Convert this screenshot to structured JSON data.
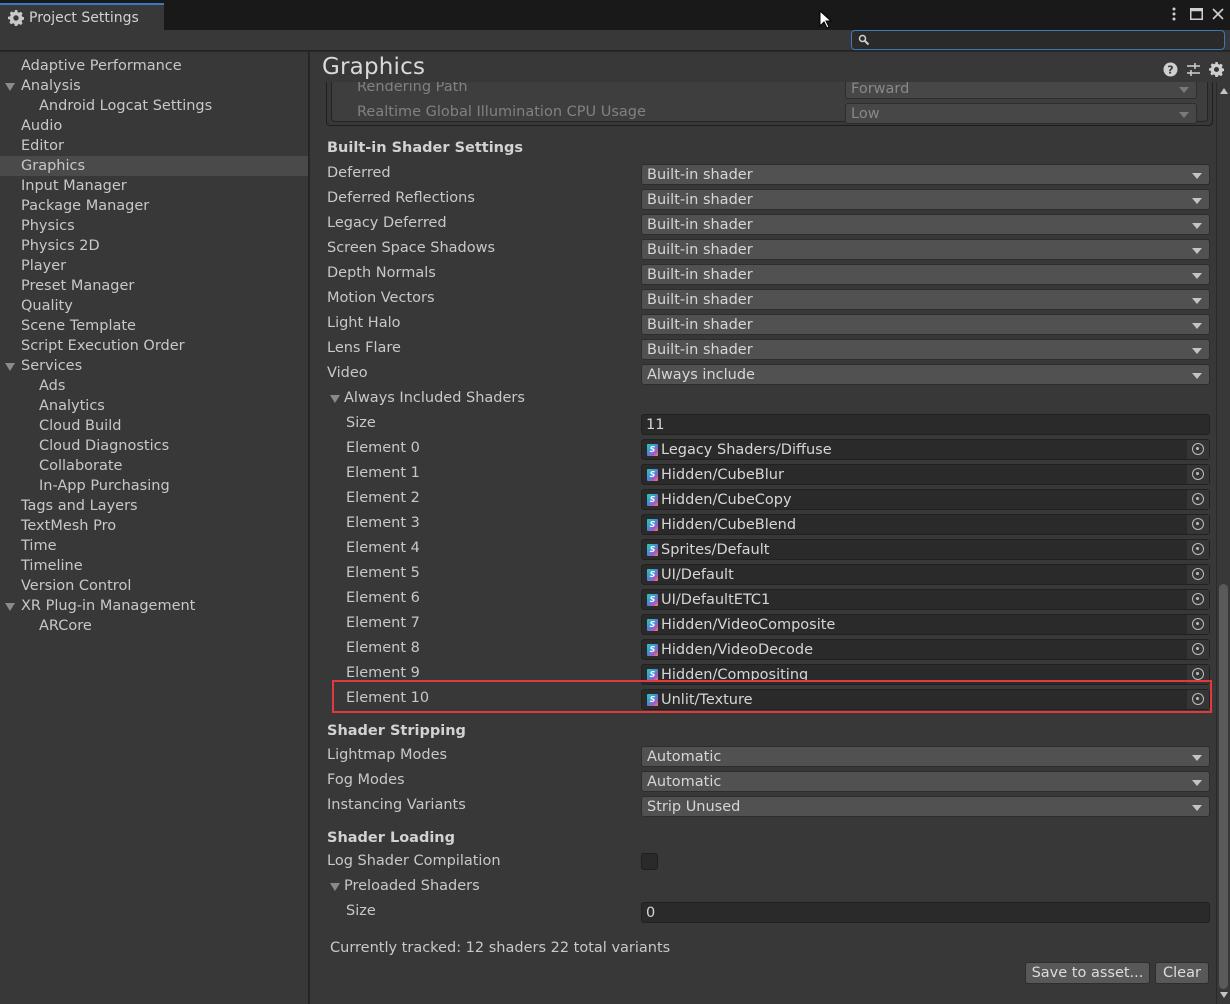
{
  "window": {
    "tab_title": "Project Settings",
    "controls": [
      "more-icon",
      "maximize-icon",
      "close-icon"
    ]
  },
  "search": {
    "value": "",
    "placeholder": ""
  },
  "sidebar": {
    "items": [
      {
        "label": "Adaptive Performance",
        "level": 0
      },
      {
        "label": "Analysis",
        "level": 0,
        "expanded": true
      },
      {
        "label": "Android Logcat Settings",
        "level": 1
      },
      {
        "label": "Audio",
        "level": 0
      },
      {
        "label": "Editor",
        "level": 0
      },
      {
        "label": "Graphics",
        "level": 0,
        "selected": true
      },
      {
        "label": "Input Manager",
        "level": 0
      },
      {
        "label": "Package Manager",
        "level": 0
      },
      {
        "label": "Physics",
        "level": 0
      },
      {
        "label": "Physics 2D",
        "level": 0
      },
      {
        "label": "Player",
        "level": 0
      },
      {
        "label": "Preset Manager",
        "level": 0
      },
      {
        "label": "Quality",
        "level": 0
      },
      {
        "label": "Scene Template",
        "level": 0
      },
      {
        "label": "Script Execution Order",
        "level": 0
      },
      {
        "label": "Services",
        "level": 0,
        "expanded": true
      },
      {
        "label": "Ads",
        "level": 1
      },
      {
        "label": "Analytics",
        "level": 1
      },
      {
        "label": "Cloud Build",
        "level": 1
      },
      {
        "label": "Cloud Diagnostics",
        "level": 1
      },
      {
        "label": "Collaborate",
        "level": 1
      },
      {
        "label": "In-App Purchasing",
        "level": 1
      },
      {
        "label": "Tags and Layers",
        "level": 0
      },
      {
        "label": "TextMesh Pro",
        "level": 0
      },
      {
        "label": "Time",
        "level": 0
      },
      {
        "label": "Timeline",
        "level": 0
      },
      {
        "label": "Version Control",
        "level": 0
      },
      {
        "label": "XR Plug-in Management",
        "level": 0,
        "expanded": true
      },
      {
        "label": "ARCore",
        "level": 1
      }
    ]
  },
  "main": {
    "title": "Graphics",
    "header_icons": [
      "help-icon",
      "presets-icon",
      "settings-icon"
    ],
    "tier_settings": [
      {
        "label": "Rendering Path",
        "value": "Forward"
      },
      {
        "label": "Realtime Global Illumination CPU Usage",
        "value": "Low"
      }
    ],
    "builtin": {
      "header": "Built-in Shader Settings",
      "rows": [
        {
          "label": "Deferred",
          "value": "Built-in shader"
        },
        {
          "label": "Deferred Reflections",
          "value": "Built-in shader"
        },
        {
          "label": "Legacy Deferred",
          "value": "Built-in shader"
        },
        {
          "label": "Screen Space Shadows",
          "value": "Built-in shader"
        },
        {
          "label": "Depth Normals",
          "value": "Built-in shader"
        },
        {
          "label": "Motion Vectors",
          "value": "Built-in shader"
        },
        {
          "label": "Light Halo",
          "value": "Built-in shader"
        },
        {
          "label": "Lens Flare",
          "value": "Built-in shader"
        },
        {
          "label": "Video",
          "value": "Always include"
        }
      ]
    },
    "always_included": {
      "label": "Always Included Shaders",
      "size_label": "Size",
      "size": "11",
      "elements": [
        {
          "label": "Element 0",
          "value": "Legacy Shaders/Diffuse"
        },
        {
          "label": "Element 1",
          "value": "Hidden/CubeBlur"
        },
        {
          "label": "Element 2",
          "value": "Hidden/CubeCopy"
        },
        {
          "label": "Element 3",
          "value": "Hidden/CubeBlend"
        },
        {
          "label": "Element 4",
          "value": "Sprites/Default"
        },
        {
          "label": "Element 5",
          "value": "UI/Default"
        },
        {
          "label": "Element 6",
          "value": "UI/DefaultETC1"
        },
        {
          "label": "Element 7",
          "value": "Hidden/VideoComposite"
        },
        {
          "label": "Element 8",
          "value": "Hidden/VideoDecode"
        },
        {
          "label": "Element 9",
          "value": "Hidden/Compositing"
        },
        {
          "label": "Element 10",
          "value": "Unlit/Texture",
          "highlighted": true
        }
      ],
      "shader_icon_letter": "S"
    },
    "stripping": {
      "header": "Shader Stripping",
      "rows": [
        {
          "label": "Lightmap Modes",
          "value": "Automatic"
        },
        {
          "label": "Fog Modes",
          "value": "Automatic"
        },
        {
          "label": "Instancing Variants",
          "value": "Strip Unused"
        }
      ]
    },
    "loading": {
      "header": "Shader Loading",
      "log_label": "Log Shader Compilation",
      "log_checked": false,
      "preloaded_label": "Preloaded Shaders",
      "size_label": "Size",
      "size": "0"
    },
    "tracked_text": "Currently tracked: 12 shaders 22 total variants",
    "save_button": "Save to asset...",
    "clear_button": "Clear",
    "highlight_color": "#e03a3e",
    "accent_color": "#3a79bb"
  }
}
